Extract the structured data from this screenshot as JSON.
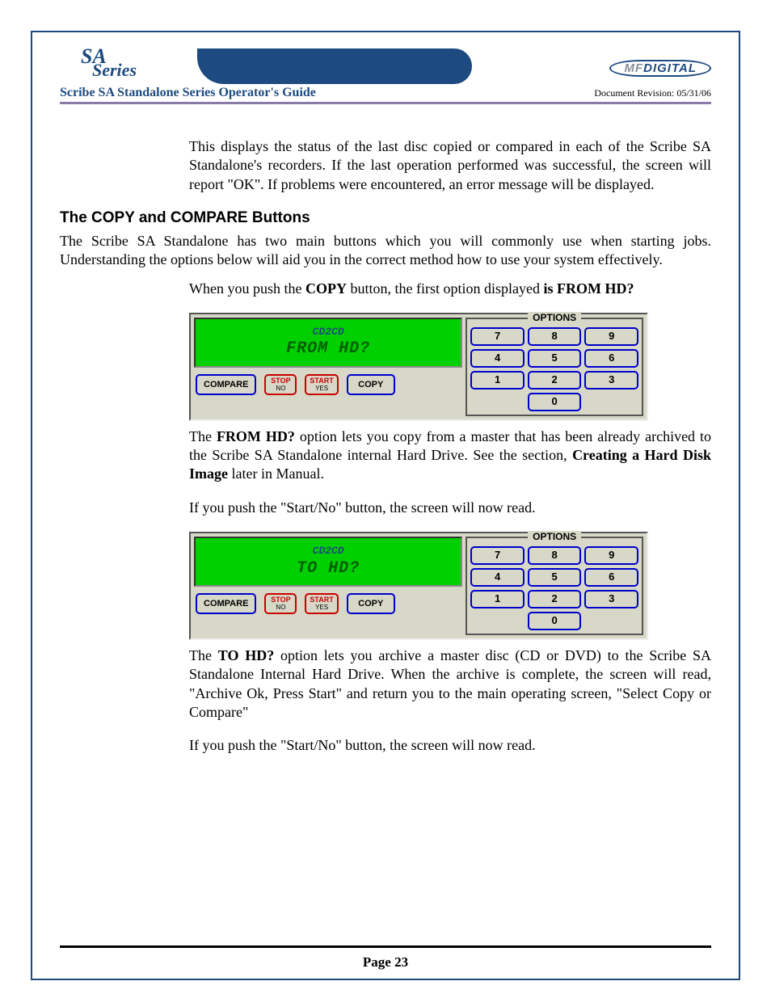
{
  "header": {
    "logo_top": "SA",
    "logo_bottom": "Series",
    "mf_label": "MF DIGITAL",
    "doc_title": "Scribe SA Standalone Series Operator's Guide",
    "revision": "Document Revision: 05/31/06"
  },
  "body": {
    "intro_para": "This displays the status of the last disc copied or compared in each of the Scribe SA Standalone's recorders. If the last operation performed was successful, the screen will report \"OK\". If problems were encountered, an error message will be displayed.",
    "section_title": "The COPY and COMPARE Buttons",
    "section_intro": "The Scribe SA Standalone has two main buttons which you will commonly use when starting jobs.  Understanding the options below will aid you in the correct method how to use your system effectively.",
    "copy_push_pre": "When you push the ",
    "copy_bold": "COPY",
    "copy_push_mid": " button, the first option displayed ",
    "copy_push_is": "is FROM HD?",
    "fromhd_pre": "The ",
    "fromhd_bold": "FROM HD?",
    "fromhd_post": " option lets you copy from a master that has been already archived to the Scribe SA Standalone internal Hard Drive. See the section, ",
    "fromhd_bold2": "Creating a Hard Disk Image",
    "fromhd_end": " later in Manual.",
    "startno1": "If you push the \"Start/No\" button, the screen will now read.",
    "tohd_pre": "The ",
    "tohd_bold": "TO HD?",
    "tohd_post": " option lets you archive a master disc (CD or DVD) to the Scribe SA Standalone Internal Hard Drive.  When the archive is complete, the screen will read, \"Archive Ok, Press Start\" and return you to the main operating screen, \"Select Copy or Compare\"",
    "startno2": "If you push the \"Start/No\" button, the screen will now read."
  },
  "panel": {
    "brand": "CD2CD",
    "lcd1": "FROM HD?",
    "lcd2": "TO HD?",
    "compare": "COMPARE",
    "stop": "STOP",
    "stop_sub": "NO",
    "start": "START",
    "start_sub": "YES",
    "copy": "COPY",
    "options": "OPTIONS",
    "keys": [
      "7",
      "8",
      "9",
      "4",
      "5",
      "6",
      "1",
      "2",
      "3",
      "0"
    ]
  },
  "footer": {
    "page": "Page 23"
  }
}
